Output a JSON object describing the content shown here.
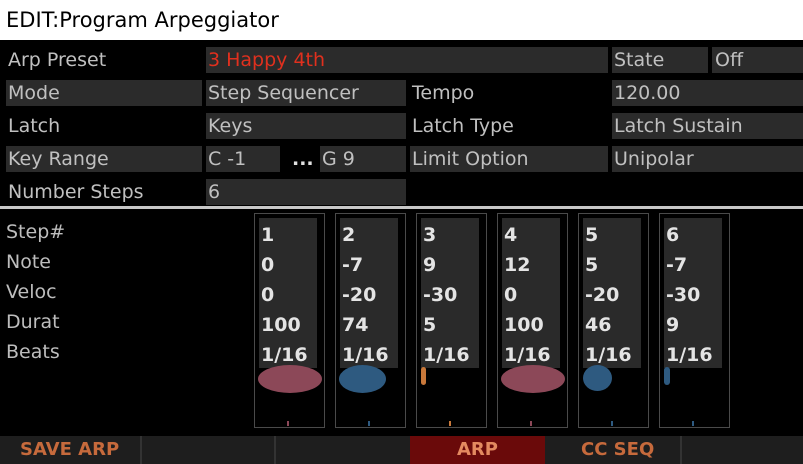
{
  "window": {
    "title": "EDIT:Program Arpeggiator"
  },
  "params": {
    "arp_preset_label": "Arp Preset",
    "arp_preset_value": "3 Happy 4th",
    "state_label": "State",
    "state_value": "Off",
    "mode_label": "Mode",
    "mode_value": "Step Sequencer",
    "tempo_label": "Tempo",
    "tempo_value": "120.00",
    "latch_label": "Latch",
    "latch_value": "Keys",
    "latch_type_label": "Latch Type",
    "latch_type_value": "Latch Sustain",
    "key_range_label": "Key Range",
    "key_range_low": "C -1",
    "key_range_dots": "...",
    "key_range_high": "G 9",
    "limit_option_label": "Limit Option",
    "limit_option_value": "Unipolar",
    "number_steps_label": "Number Steps",
    "number_steps_value": "6"
  },
  "row_labels": [
    "Step#",
    "Note",
    "Veloc",
    "Durat",
    "Beats"
  ],
  "steps": [
    {
      "step": "1",
      "note": "0",
      "veloc": "0",
      "durat": "100",
      "beats": "1/16",
      "color": "#8c4858",
      "fill": 1.0
    },
    {
      "step": "2",
      "note": "-7",
      "veloc": "-20",
      "durat": "74",
      "beats": "1/16",
      "color": "#2e5a80",
      "fill": 0.74
    },
    {
      "step": "3",
      "note": "9",
      "veloc": "-30",
      "durat": "5",
      "beats": "1/16",
      "color": "#c8783a",
      "fill": 0.05
    },
    {
      "step": "4",
      "note": "12",
      "veloc": "0",
      "durat": "100",
      "beats": "1/16",
      "color": "#8c4858",
      "fill": 1.0
    },
    {
      "step": "5",
      "note": "5",
      "veloc": "-20",
      "durat": "46",
      "beats": "1/16",
      "color": "#2e5a80",
      "fill": 0.46
    },
    {
      "step": "6",
      "note": "-7",
      "veloc": "-30",
      "durat": "9",
      "beats": "1/16",
      "color": "#2e5a80",
      "fill": 0.09
    }
  ],
  "softkeys": {
    "save_arp": "SAVE ARP",
    "arp": "ARP",
    "cc_seq": "CC SEQ"
  }
}
